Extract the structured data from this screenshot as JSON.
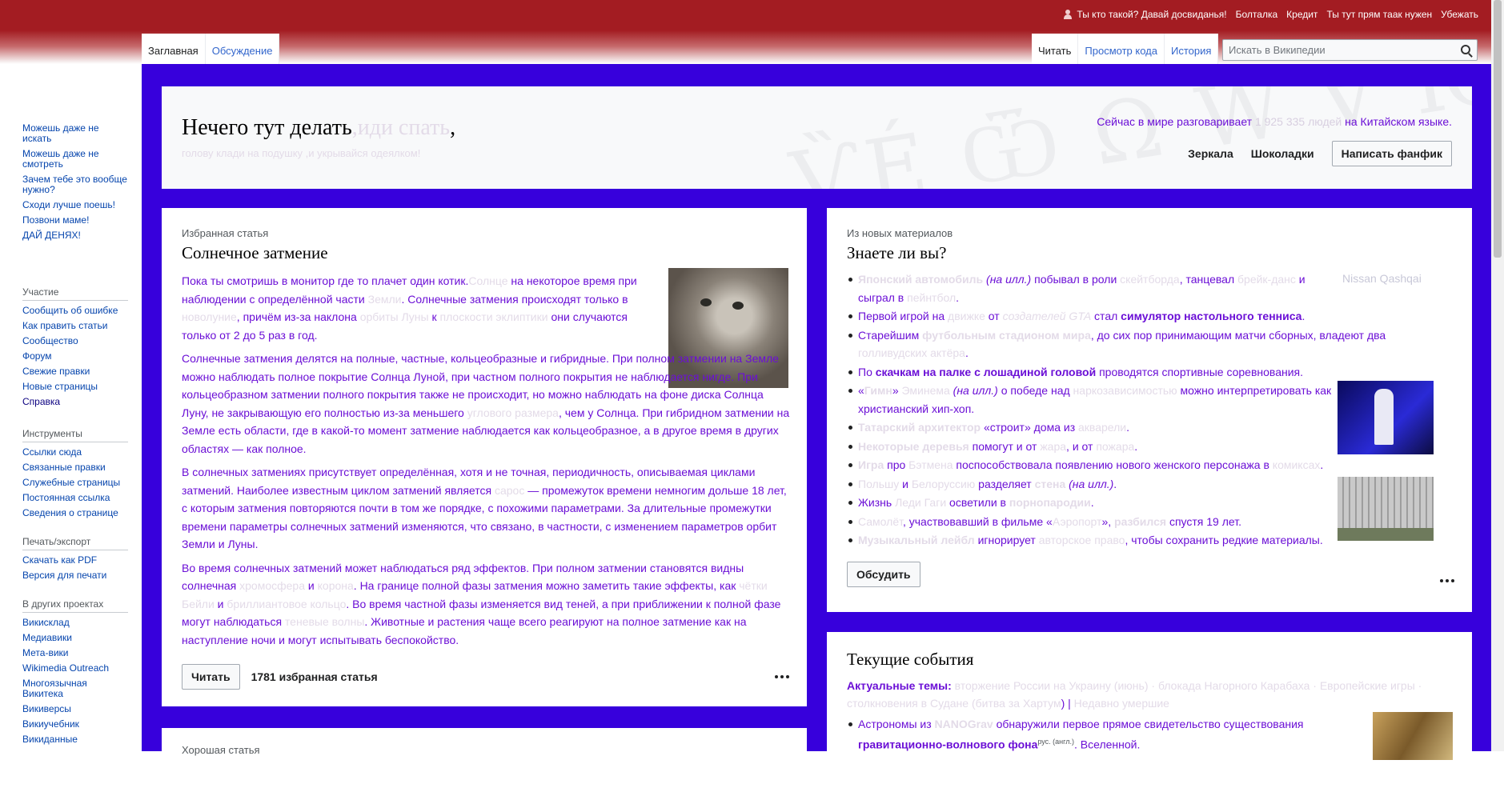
{
  "personal_tools": [
    "Ты кто такой? Давай досвиданья!",
    "Болталка",
    "Кредит",
    "Ты тут прям таак нужен",
    "Убежать"
  ],
  "left_tabs": [
    "Заглавная",
    "Обсуждение"
  ],
  "right_tabs": [
    "Читать",
    "Просмотр кода",
    "История"
  ],
  "search": {
    "placeholder": "Искать в Википедии"
  },
  "sidebar": {
    "nav": [
      "Можешь даже не искать",
      "Можешь даже не смотреть",
      "Зачем тебе это вообще нужно?",
      "Сходи лучше поешь!",
      "Позвони маме!",
      "ДАЙ ДЕНЯХ!"
    ],
    "participation": {
      "title": "Участие",
      "items": [
        "Сообщить об ошибке",
        "Как править статьи",
        "Сообщество",
        "Форум",
        "Свежие правки",
        "Новые страницы",
        "Справка"
      ]
    },
    "tools": {
      "title": "Инструменты",
      "items": [
        "Ссылки сюда",
        "Связанные правки",
        "Служебные страницы",
        "Постоянная ссылка",
        "Сведения о странице"
      ]
    },
    "print": {
      "title": "Печать/экспорт",
      "items": [
        "Скачать как PDF",
        "Версия для печати"
      ]
    },
    "projects": {
      "title": "В других проектах",
      "items": [
        "Викисклад",
        "Медиавики",
        "Мета-вики",
        "Wikimedia Outreach",
        "Многоязычная Викитека",
        "Викиверсы",
        "Викиучебник",
        "Викиданные"
      ]
    }
  },
  "banner": {
    "title_main": "Нечего тут делать",
    "title_faded": ",иди спать",
    "title_comma": ",",
    "subtitle": "голову клади на подушку ,и укрывайся одеялком!",
    "speakers_pre": "Сейчас в мире разговаривает",
    "speakers_num": "1 925 335 людей",
    "speakers_post": "на Китайском языке.",
    "btn_mirrors": "Зеркала",
    "btn_choc": "Шоколадки",
    "btn_fanfic": "Написать фанфик",
    "watermark": "ѶÉ Ѿ Ω W Ɐ Ѥ"
  },
  "featured": {
    "kicker": "Избранная статья",
    "title": "Солнечное затмение",
    "p1_a": "Пока ты смотришь в монитор где то плачет один котик.",
    "p1_b": "Солнце",
    "p1_c": " на некоторое время при наблюдении с определённой части ",
    "p1_d": "Земли",
    "p1_e": ". Солнечные затмения происходят только в ",
    "p1_f": "новолуние",
    "p1_g": ", причём из-за наклона ",
    "p1_h": "орбиты Луны",
    "p1_i": " к ",
    "p1_j": "плоскости эклиптики",
    "p1_k": " они случаются только от 2 до 5 раз в год.",
    "p2_a": "Солнечные затмения делятся на полные, частные, кольцеобразные и гибридные. При полном затмении на Земле можно наблюдать полное покрытие Солнца Луной, при частном полного покрытия не наблюдается нигде. При кольцеобразном затмении полного покрытия также не происходит, но можно наблюдать на фоне диска Солнца Луну, не закрывающую его полностью из-за меньшего ",
    "p2_b": "углового размера",
    "p2_c": ", чем у Солнца. При гибридном затмении на Земле есть области, где в какой-то момент затмение наблюдается как кольцеобразное, а в другое время в других областях — как полное.",
    "p3_a": "В солнечных затмениях присутствует определённая, хотя и не точная, периодичность, описываемая циклами затмений. Наиболее известным циклом затмений является ",
    "p3_b": "сарос",
    "p3_c": " — промежуток времени немногим дольше 18 лет, с которым затмения повторяются почти в том же порядке, с похожими параметрами. За длительные промежутки времени параметры солнечных затмений изменяются, что связано, в частности, с изменением параметров орбит Земли и Луны.",
    "p4_a": "Во время солнечных затмений может наблюдаться ряд эффектов. При полном затмении становятся видны солнечная ",
    "p4_b": "хромосфера",
    "p4_c": " и ",
    "p4_d": "корона",
    "p4_e": ". На границе полной фазы затмения можно заметить такие эффекты, как ",
    "p4_f": "чётки Бейли",
    "p4_g": " и ",
    "p4_h": "бриллиантовое кольцо",
    "p4_i": ". Во время частной фазы изменяется вид теней, а при приближении к полной фазе могут наблюдаться ",
    "p4_j": "теневые волны",
    "p4_k": ". Животные и растения чаще всего реагируют на полное затмение как на наступление ночи и могут испытывать беспокойство.",
    "read_btn": "Читать",
    "count": "1781 избранная статья"
  },
  "dyk": {
    "kicker": "Из новых материалов",
    "title": "Знаете ли вы?",
    "nissan_alt": "Nissan Qashqai",
    "items": [
      [
        "Японский автомобиль",
        " (на илл.)",
        " побывал в роли ",
        "скейтборда",
        ", танцевал ",
        "брейк-данс",
        " и сыграл в ",
        "пейнтбол",
        "."
      ],
      [
        "Первой игрой на ",
        "движке",
        " от ",
        "создателей GTA",
        " стал ",
        "симулятор настольного тенниса",
        "."
      ],
      [
        "Старейшим ",
        "футбольным стадионом мира",
        ", до сих пор принимающим матчи сборных, владеют два ",
        "голливудских актёра",
        "."
      ],
      [
        "По ",
        "скачкам на палке с лошадиной головой",
        " проводятся спортивные соревнования."
      ],
      [
        "«",
        "Гимн",
        "» ",
        "Эминема",
        " (на илл.)",
        " о победе над ",
        "наркозависимостью",
        " можно интерпретировать как христианский хип-хоп."
      ],
      [
        "Татарский архитектор",
        " «строит» дома из ",
        "акварели",
        "."
      ],
      [
        "Некоторые деревья",
        " помогут и от ",
        "жара",
        ", и от ",
        "пожара",
        "."
      ],
      [
        "Игра",
        " про ",
        "Бэтмена",
        " поспособствовала появлению нового женского персонажа в ",
        "комиксах",
        "."
      ],
      [
        "Польшу",
        " и ",
        "Белоруссию",
        " разделяет ",
        "стена",
        " (на илл.)",
        "."
      ],
      [
        "Жизнь ",
        "Леди Гаги",
        " осветили в ",
        "порнопародии",
        "."
      ],
      [
        "Самолёт",
        ", участвовавший в фильме «",
        "Аэропорт",
        "», ",
        "разбился",
        " спустя 19 лет."
      ],
      [
        "Музыкальный лейбл",
        " игнорирует ",
        "авторское право",
        ", чтобы сохранить редкие материалы."
      ]
    ],
    "discuss_btn": "Обсудить"
  },
  "current": {
    "title": "Текущие события",
    "topics_label": "Актуальные темы:",
    "topics_a": " вторжение России на Украину (",
    "topics_b": "июнь",
    "topics_c": ") · блокада Нагорного Карабаха · Европейские игры · столкновения в Судане (",
    "topics_d": "битва за Хартум",
    "topics_e": ") | ",
    "topics_f": "Недавно умершие",
    "news_a": "Астрономы из ",
    "news_b": "NANOGrav",
    "news_c": " обнаружили первое прямое свидетельство существования ",
    "news_d": "гравитационно-волнового фона",
    "news_sup": "рус. (англ.)",
    "news_e": ". Вселенной."
  },
  "good": {
    "kicker": "Хорошая статья"
  }
}
